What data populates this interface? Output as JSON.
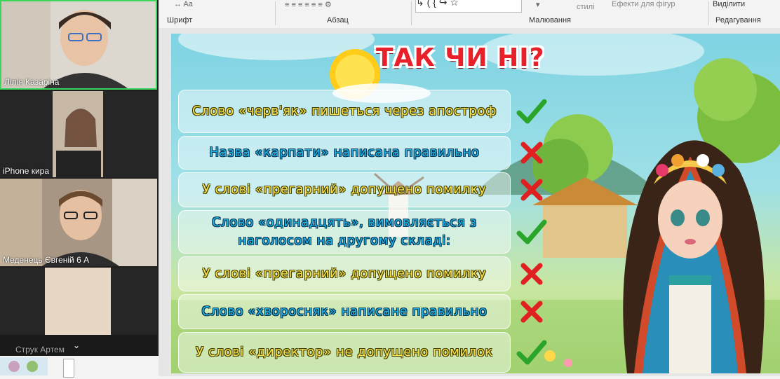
{
  "participants": [
    {
      "name": "Лілія Казаріна"
    },
    {
      "name": "iPhone кира"
    },
    {
      "name": "Меденець Євгеній 6 А"
    },
    {
      "name": "Струк Артем"
    }
  ],
  "ribbon": {
    "groups": [
      "Шрифт",
      "Абзац",
      "Малювання",
      "Редагування"
    ],
    "styles_label": "стилі",
    "effects_label": "Ефекти для фігур",
    "select_label": "Виділити"
  },
  "slide": {
    "title": "ТАК ЧИ НІ?",
    "statements": [
      {
        "text": "Слово «черв'як» пишеться через апостроф",
        "answer": "yes",
        "style": "yellow"
      },
      {
        "text": "Назва «карпати» написана правильно",
        "answer": "no",
        "style": "blue"
      },
      {
        "text": "У слові «прегарний» допущено помилку",
        "answer": "no",
        "style": "yellow"
      },
      {
        "text": "Слово «одинадцять», вимовляється з наголосом на другому складі:",
        "answer": "yes",
        "style": "blue"
      },
      {
        "text": "У слові «прегарний» допущено помилку",
        "answer": "no",
        "style": "yellow"
      },
      {
        "text": "Слово «хворосняк» написане правильно",
        "answer": "no",
        "style": "blue"
      },
      {
        "text": "У слові «директор» не допущено помилок",
        "answer": "yes",
        "style": "yellow"
      }
    ]
  },
  "colors": {
    "yes": "#2aa52a",
    "no": "#e02020",
    "active_border": "#3ad65b"
  }
}
